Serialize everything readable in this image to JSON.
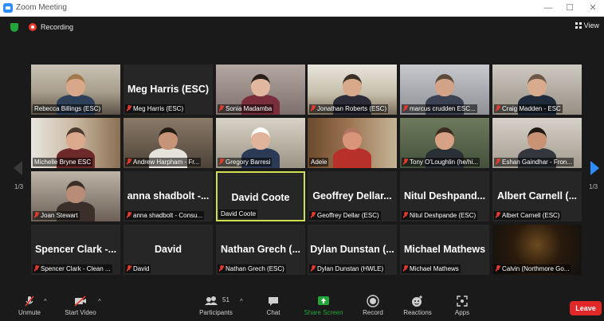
{
  "window": {
    "title": "Zoom Meeting",
    "minimize": "—",
    "maximize": "☐",
    "close": "✕"
  },
  "status": {
    "recording": "Recording",
    "view": "View"
  },
  "pages": {
    "left": "1/3",
    "right": "1/3"
  },
  "tiles": [
    {
      "label": "Rebecca Billings (ESC)",
      "muted": false,
      "big": ""
    },
    {
      "label": "Meg Harris (ESC)",
      "muted": true,
      "big": "Meg Harris (ESC)"
    },
    {
      "label": "Sonia Madamba",
      "muted": true,
      "big": ""
    },
    {
      "label": "Jonathan Roberts (ESC)",
      "muted": true,
      "big": ""
    },
    {
      "label": "marcus crudden ESC...",
      "muted": true,
      "big": ""
    },
    {
      "label": "Craig Madden - ESC",
      "muted": true,
      "big": ""
    },
    {
      "label": "Michelle Bryne ESC",
      "muted": false,
      "big": ""
    },
    {
      "label": "Andrew Harpham - Fr...",
      "muted": true,
      "big": ""
    },
    {
      "label": "Gregory Barresi",
      "muted": true,
      "big": ""
    },
    {
      "label": "Adele",
      "muted": false,
      "big": ""
    },
    {
      "label": "Tony O'Loughlin (he/hi...",
      "muted": true,
      "big": ""
    },
    {
      "label": "Eshan Gaindhar - Fron...",
      "muted": true,
      "big": ""
    },
    {
      "label": "Joan Stewart",
      "muted": true,
      "big": ""
    },
    {
      "label": "anna shadbolt - Consu...",
      "muted": true,
      "big": "anna shadbolt -..."
    },
    {
      "label": "David Coote",
      "muted": false,
      "big": "David Coote"
    },
    {
      "label": "Geoffrey Dellar (ESC)",
      "muted": true,
      "big": "Geoffrey Dellar..."
    },
    {
      "label": "Nitul Deshpande (ESC)",
      "muted": true,
      "big": "Nitul Deshpand..."
    },
    {
      "label": "Albert Carnell (ESC)",
      "muted": true,
      "big": "Albert Carnell (..."
    },
    {
      "label": "Spencer Clark - Clean ...",
      "muted": true,
      "big": "Spencer Clark -..."
    },
    {
      "label": "David",
      "muted": true,
      "big": "David"
    },
    {
      "label": "Nathan Grech (ESC)",
      "muted": true,
      "big": "Nathan Grech (..."
    },
    {
      "label": "Dylan Dunstan (HWLE)",
      "muted": true,
      "big": "Dylan Dunstan (..."
    },
    {
      "label": "Michael Mathews",
      "muted": true,
      "big": "Michael Mathews"
    },
    {
      "label": "Calvin (Northmore Go...",
      "muted": true,
      "big": ""
    }
  ],
  "toolbar": {
    "unmute": "Unmute",
    "start_video": "Start Video",
    "participants": "Participants",
    "participants_count": "51",
    "chat": "Chat",
    "share_screen": "Share Screen",
    "record": "Record",
    "reactions": "Reactions",
    "apps": "Apps",
    "leave": "Leave"
  },
  "colors": {
    "active_speaker": "#cfe04e",
    "share_green": "#23a639",
    "leave_red": "#e02828",
    "muted_red": "#e5392d",
    "accent_blue": "#2d8cff"
  }
}
